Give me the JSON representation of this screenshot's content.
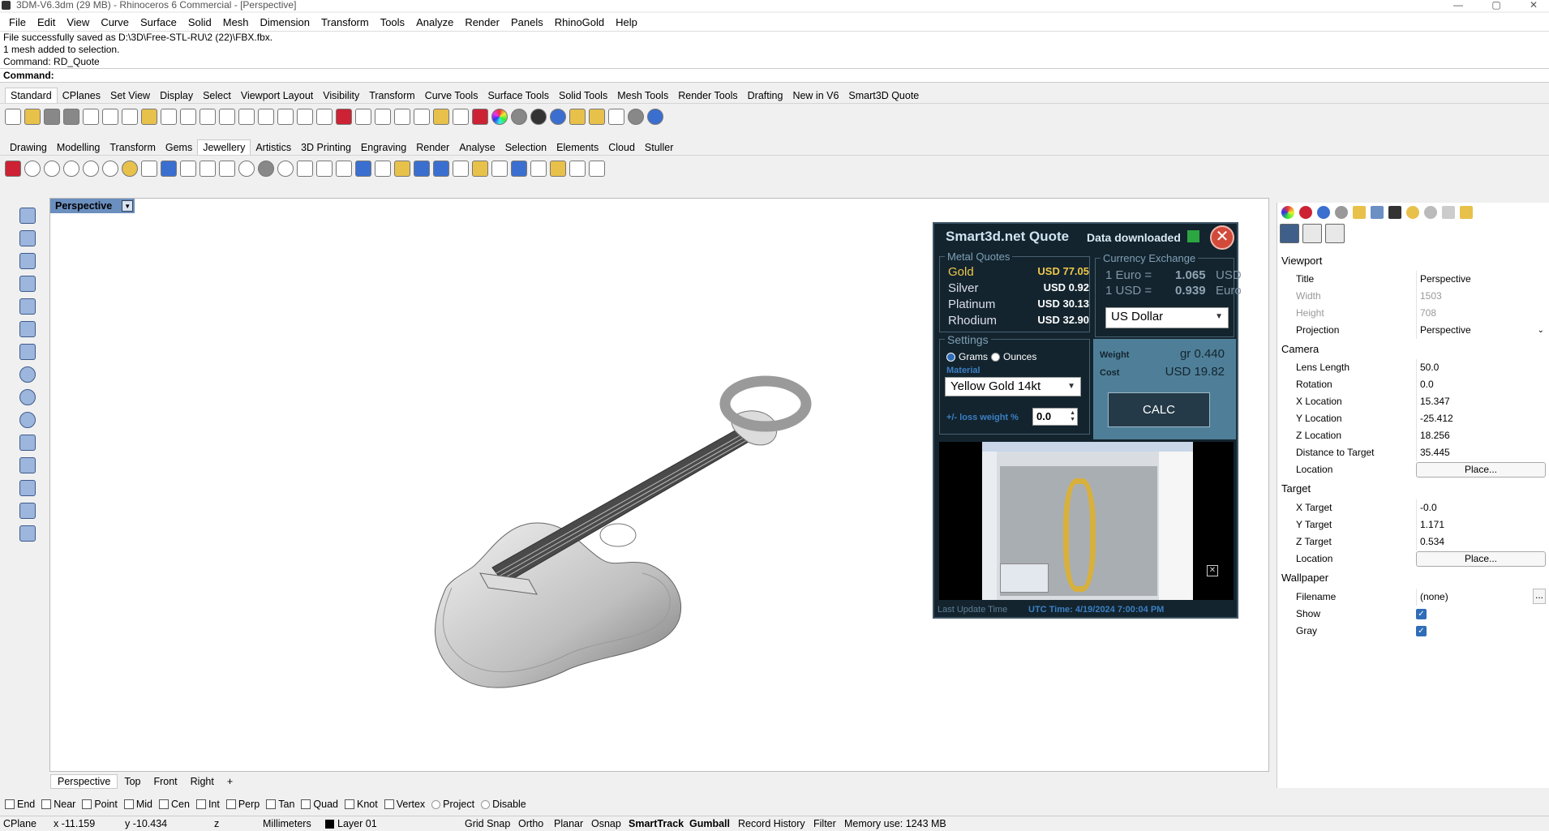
{
  "window": {
    "title": "3DM-V6.3dm (29 MB) - Rhinoceros 6 Commercial - [Perspective]",
    "controls": [
      "—",
      "▢",
      "✕"
    ]
  },
  "menu": [
    "File",
    "Edit",
    "View",
    "Curve",
    "Surface",
    "Solid",
    "Mesh",
    "Dimension",
    "Transform",
    "Tools",
    "Analyze",
    "Render",
    "Panels",
    "RhinoGold",
    "Help"
  ],
  "command_history": [
    "File successfully saved as D:\\3D\\Free-STL-RU\\2 (22)\\FBX.fbx.",
    "1 mesh added to selection.",
    "Command: RD_Quote"
  ],
  "command_prompt": "Command:",
  "toolbar_tabs": [
    "Standard",
    "CPlanes",
    "Set View",
    "Display",
    "Select",
    "Viewport Layout",
    "Visibility",
    "Transform",
    "Curve Tools",
    "Surface Tools",
    "Solid Tools",
    "Mesh Tools",
    "Render Tools",
    "Drafting",
    "New in V6",
    "Smart3D Quote"
  ],
  "plugin_tabs": [
    "Drawing",
    "Modelling",
    "Transform",
    "Gems",
    "Jewellery",
    "Artistics",
    "3D Printing",
    "Engraving",
    "Render",
    "Analyse",
    "Selection",
    "Elements",
    "Cloud",
    "Stuller"
  ],
  "viewport": {
    "label": "Perspective",
    "tabs": [
      "Perspective",
      "Top",
      "Front",
      "Right"
    ],
    "add_tab": "+"
  },
  "quote": {
    "title": "Smart3d.net Quote",
    "status": "Data downloaded",
    "close": "✕",
    "metal_group": "Metal Quotes",
    "metals": [
      {
        "name": "Gold",
        "price": "USD 77.05"
      },
      {
        "name": "Silver",
        "price": "USD 0.92"
      },
      {
        "name": "Platinum",
        "price": "USD 30.13"
      },
      {
        "name": "Rhodium",
        "price": "USD 32.90"
      }
    ],
    "currency_group": "Currency Exchange",
    "rates": [
      {
        "from": "1 Euro =",
        "value": "1.065",
        "unit": "USD"
      },
      {
        "from": "1 USD =",
        "value": "0.939",
        "unit": "Euro"
      }
    ],
    "currency_select": "US Dollar",
    "settings_group": "Settings",
    "unit_grams": "Grams",
    "unit_ounces": "Ounces",
    "material_label": "Material",
    "material_select": "Yellow Gold 14kt",
    "loss_label": "+/- loss weight %",
    "loss_value": "0.0",
    "weight_label": "Weight",
    "weight_value": "gr 0.440",
    "cost_label": "Cost",
    "cost_value": "USD  19.82",
    "calc": "CALC",
    "last_update_label": "Last Update Time",
    "utc_time": "UTC Time: 4/19/2024 7:00:04 PM"
  },
  "properties": {
    "viewport_header": "Viewport",
    "viewport_rows": [
      {
        "k": "Title",
        "v": "Perspective",
        "dis": false
      },
      {
        "k": "Width",
        "v": "1503",
        "dis": true
      },
      {
        "k": "Height",
        "v": "708",
        "dis": true
      },
      {
        "k": "Projection",
        "v": "Perspective",
        "dis": false
      }
    ],
    "camera_header": "Camera",
    "camera_rows": [
      {
        "k": "Lens Length",
        "v": "50.0"
      },
      {
        "k": "Rotation",
        "v": "0.0"
      },
      {
        "k": "X Location",
        "v": "15.347"
      },
      {
        "k": "Y Location",
        "v": "-25.412"
      },
      {
        "k": "Z Location",
        "v": "18.256"
      },
      {
        "k": "Distance to Target",
        "v": "35.445"
      }
    ],
    "camera_location_label": "Location",
    "place_button": "Place...",
    "target_header": "Target",
    "target_rows": [
      {
        "k": "X Target",
        "v": "-0.0"
      },
      {
        "k": "Y Target",
        "v": "1.171"
      },
      {
        "k": "Z Target",
        "v": "0.534"
      }
    ],
    "target_location_label": "Location",
    "wallpaper_header": "Wallpaper",
    "filename_label": "Filename",
    "filename_value": "(none)",
    "filename_browse": "...",
    "show_label": "Show",
    "gray_label": "Gray"
  },
  "osnap": [
    "End",
    "Near",
    "Point",
    "Mid",
    "Cen",
    "Int",
    "Perp",
    "Tan",
    "Quad",
    "Knot",
    "Vertex"
  ],
  "osnap_radio": [
    "Project",
    "Disable"
  ],
  "status": {
    "cplane": "CPlane",
    "x": "x -11.159",
    "y": "y -10.434",
    "z": "z",
    "units": "Millimeters",
    "layer": "Layer 01",
    "grid_snap": "Grid Snap",
    "ortho": "Ortho",
    "planar": "Planar",
    "osnap": "Osnap",
    "smarttrack": "SmartTrack",
    "gumball": "Gumball",
    "record_history": "Record History",
    "filter": "Filter",
    "memory": "Memory use: 1243 MB"
  },
  "colors": {
    "quote_bg": "#13242e",
    "gold": "#f0c84a",
    "accent": "#2f6db8",
    "led": "#2ca640"
  }
}
